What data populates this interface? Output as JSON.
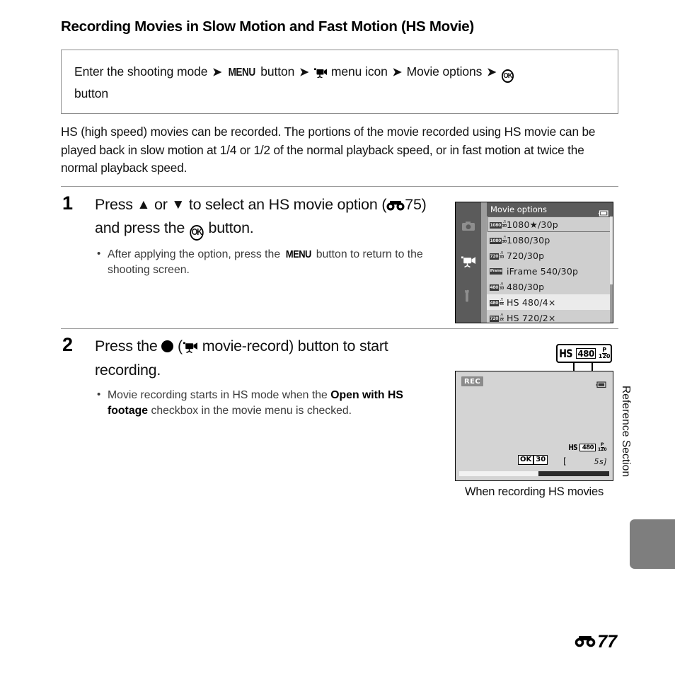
{
  "page": {
    "title": "Recording Movies in Slow Motion and Fast Motion (HS Movie)",
    "folio_number": "77",
    "folio_symbol": "E-mark",
    "side_label": "Reference Section"
  },
  "nav_box": {
    "segments": [
      {
        "type": "text",
        "value": "Enter the shooting mode"
      },
      {
        "type": "arrow",
        "value": "➔"
      },
      {
        "type": "menu-glyph",
        "value": "MENU"
      },
      {
        "type": "text",
        "value": "button"
      },
      {
        "type": "arrow",
        "value": "➔"
      },
      {
        "type": "icon",
        "value": "movie-camera-icon"
      },
      {
        "type": "text",
        "value": "menu icon"
      },
      {
        "type": "arrow",
        "value": "➔"
      },
      {
        "type": "text",
        "value": "Movie options"
      },
      {
        "type": "arrow",
        "value": "➔"
      },
      {
        "type": "ok-glyph",
        "value": "OK"
      },
      {
        "type": "text",
        "value": "button"
      }
    ],
    "line1_a": "Enter the shooting mode",
    "menu_label": "MENU",
    "button_word": "button",
    "menu_icon_word": "menu icon",
    "movie_options_word": "Movie options",
    "ok_label": "OK",
    "line2": "button"
  },
  "intro": "HS (high speed) movies can be recorded. The portions of the movie recorded using HS movie can be played back in slow motion at 1/4 or 1/2 of the normal playback speed, or in fast motion at twice the normal playback speed.",
  "steps": [
    {
      "number": "1",
      "head_a": "Press",
      "up_arrow": "▲",
      "head_or": "or",
      "down_arrow": "▼",
      "head_b": "to select an HS movie option",
      "head_ref_open": "(",
      "head_ref_num": "75",
      "head_ref_close": ") and press the",
      "ok_label": "OK",
      "head_c": "button.",
      "bullet_a": "After applying the option, press the",
      "bullet_menu": "MENU",
      "bullet_b": "button to return to the shooting screen."
    },
    {
      "number": "2",
      "head_a": "Press the",
      "head_paren_open": "(",
      "head_b": "movie-record) button to start recording.",
      "bullet_a": "Movie recording starts in HS mode when the",
      "bullet_bold1": "Open with",
      "bullet_bold2": "HS footage",
      "bullet_b": "checkbox in the movie menu is checked."
    }
  ],
  "menu_screenshot": {
    "title": "Movie options",
    "sidebar_icons": [
      "camera-icon",
      "movie-camera-icon",
      "wrench-icon"
    ],
    "sidebar_active_index": 1,
    "battery_icon": "battery-icon",
    "focused_index": 0,
    "selected_index": 5,
    "rows": [
      {
        "icon_res": "1080",
        "icon_fps": "30",
        "label": "1080★/30p"
      },
      {
        "icon_res": "1080",
        "icon_fps": "30",
        "label": "1080/30p"
      },
      {
        "icon_res": "720",
        "icon_fps": "30",
        "label": "720/30p"
      },
      {
        "icon_res": "iFrame",
        "icon_fps": "",
        "label": "iFrame 540/30p"
      },
      {
        "icon_res": "480",
        "icon_fps": "30",
        "label": "480/30p"
      },
      {
        "icon_res": "480",
        "icon_fps": "4x",
        "label": "HS 480/4×"
      },
      {
        "icon_res": "720",
        "icon_fps": "2x",
        "label": "HS 720/2×"
      }
    ]
  },
  "recording_screenshot": {
    "callout": {
      "hs": "HS",
      "res": "480",
      "p_top": "P",
      "p_bottom": "120"
    },
    "rec_badge": "REC",
    "battery_icon": "battery-icon",
    "ok_button": "OK",
    "ok_value": "30",
    "left_bracket": "[",
    "time_remaining": "5s",
    "right_bracket": "]",
    "hs_indicator": {
      "hs": "HS",
      "res": "480",
      "p_top": "P",
      "p_bottom": "120"
    },
    "progress_percent": 53,
    "caption": "When recording HS movies"
  },
  "colors": {
    "menu_sidebar": "#5b5b5b",
    "menu_panel": "#cfcfcf",
    "menu_selected": "#ebebeb",
    "screen_bg": "#d4d4d4",
    "rule": "#9a9a9a",
    "side_tab": "#7e7e7e"
  }
}
